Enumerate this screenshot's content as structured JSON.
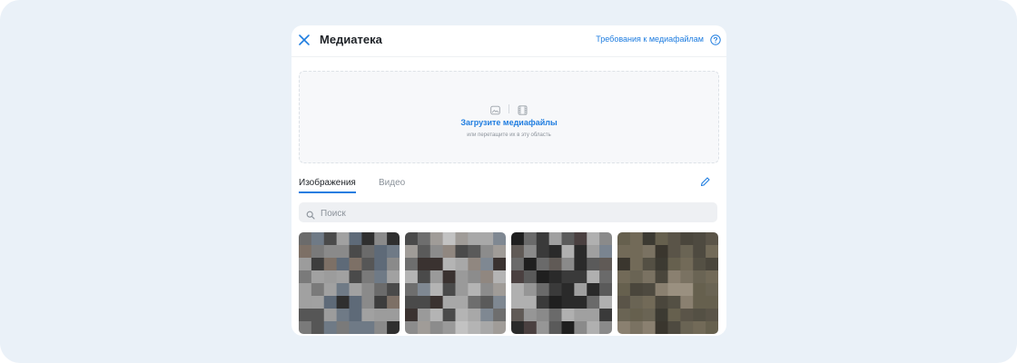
{
  "panel": {
    "title": "Медиатека",
    "requirements_link": "Требования к медиафайлам"
  },
  "dropzone": {
    "title": "Загрузите медиафайлы",
    "subtitle": "или перетащите их в эту область"
  },
  "tabs": [
    {
      "label": "Изображения",
      "active": true
    },
    {
      "label": "Видео",
      "active": false
    }
  ],
  "search": {
    "placeholder": "Поиск",
    "value": ""
  },
  "icons": {
    "close": "close-icon",
    "help": "help-circle-icon",
    "image": "image-icon",
    "video": "film-icon",
    "edit": "pencil-icon",
    "search": "search-icon"
  },
  "colors": {
    "accent": "#1f7de0",
    "background": "#eaf1f8",
    "panel": "#ffffff"
  },
  "thumbnails": [
    {
      "name": "image-thumbnail-1",
      "blurred": true,
      "palette": [
        "#6b6b6b",
        "#7a7a7a",
        "#8a8a8a",
        "#565656",
        "#3d3d3d",
        "#9c9c9c",
        "#6f7a86",
        "#2f2f2f",
        "#a1a1a1",
        "#4a4a4a",
        "#5e6a78",
        "#7d7066"
      ]
    },
    {
      "name": "image-thumbnail-2",
      "blurred": true,
      "palette": [
        "#9a9a9a",
        "#a8a8a8",
        "#8c8c8c",
        "#6e6e6e",
        "#b4b4b4",
        "#7f8892",
        "#3a3230",
        "#c2c2c2",
        "#5a5a5a",
        "#908780",
        "#4a4a4a",
        "#a09c98"
      ]
    },
    {
      "name": "image-thumbnail-3",
      "blurred": true,
      "palette": [
        "#5a5a5a",
        "#6a6a6a",
        "#3a3a3a",
        "#8a8a8a",
        "#2a2a2a",
        "#7a8490",
        "#a0a0a0",
        "#4a4040",
        "#1f1f1f",
        "#969696",
        "#605a56",
        "#b0b0b0"
      ]
    },
    {
      "name": "image-thumbnail-4",
      "blurred": true,
      "palette": [
        "#5a5448",
        "#6a6454",
        "#4a463c",
        "#7a7262",
        "#3c3a32",
        "#8a8070",
        "#66604e",
        "#545044",
        "#9a9080",
        "#4e4a40",
        "#726a58",
        "#3a362e"
      ]
    }
  ]
}
